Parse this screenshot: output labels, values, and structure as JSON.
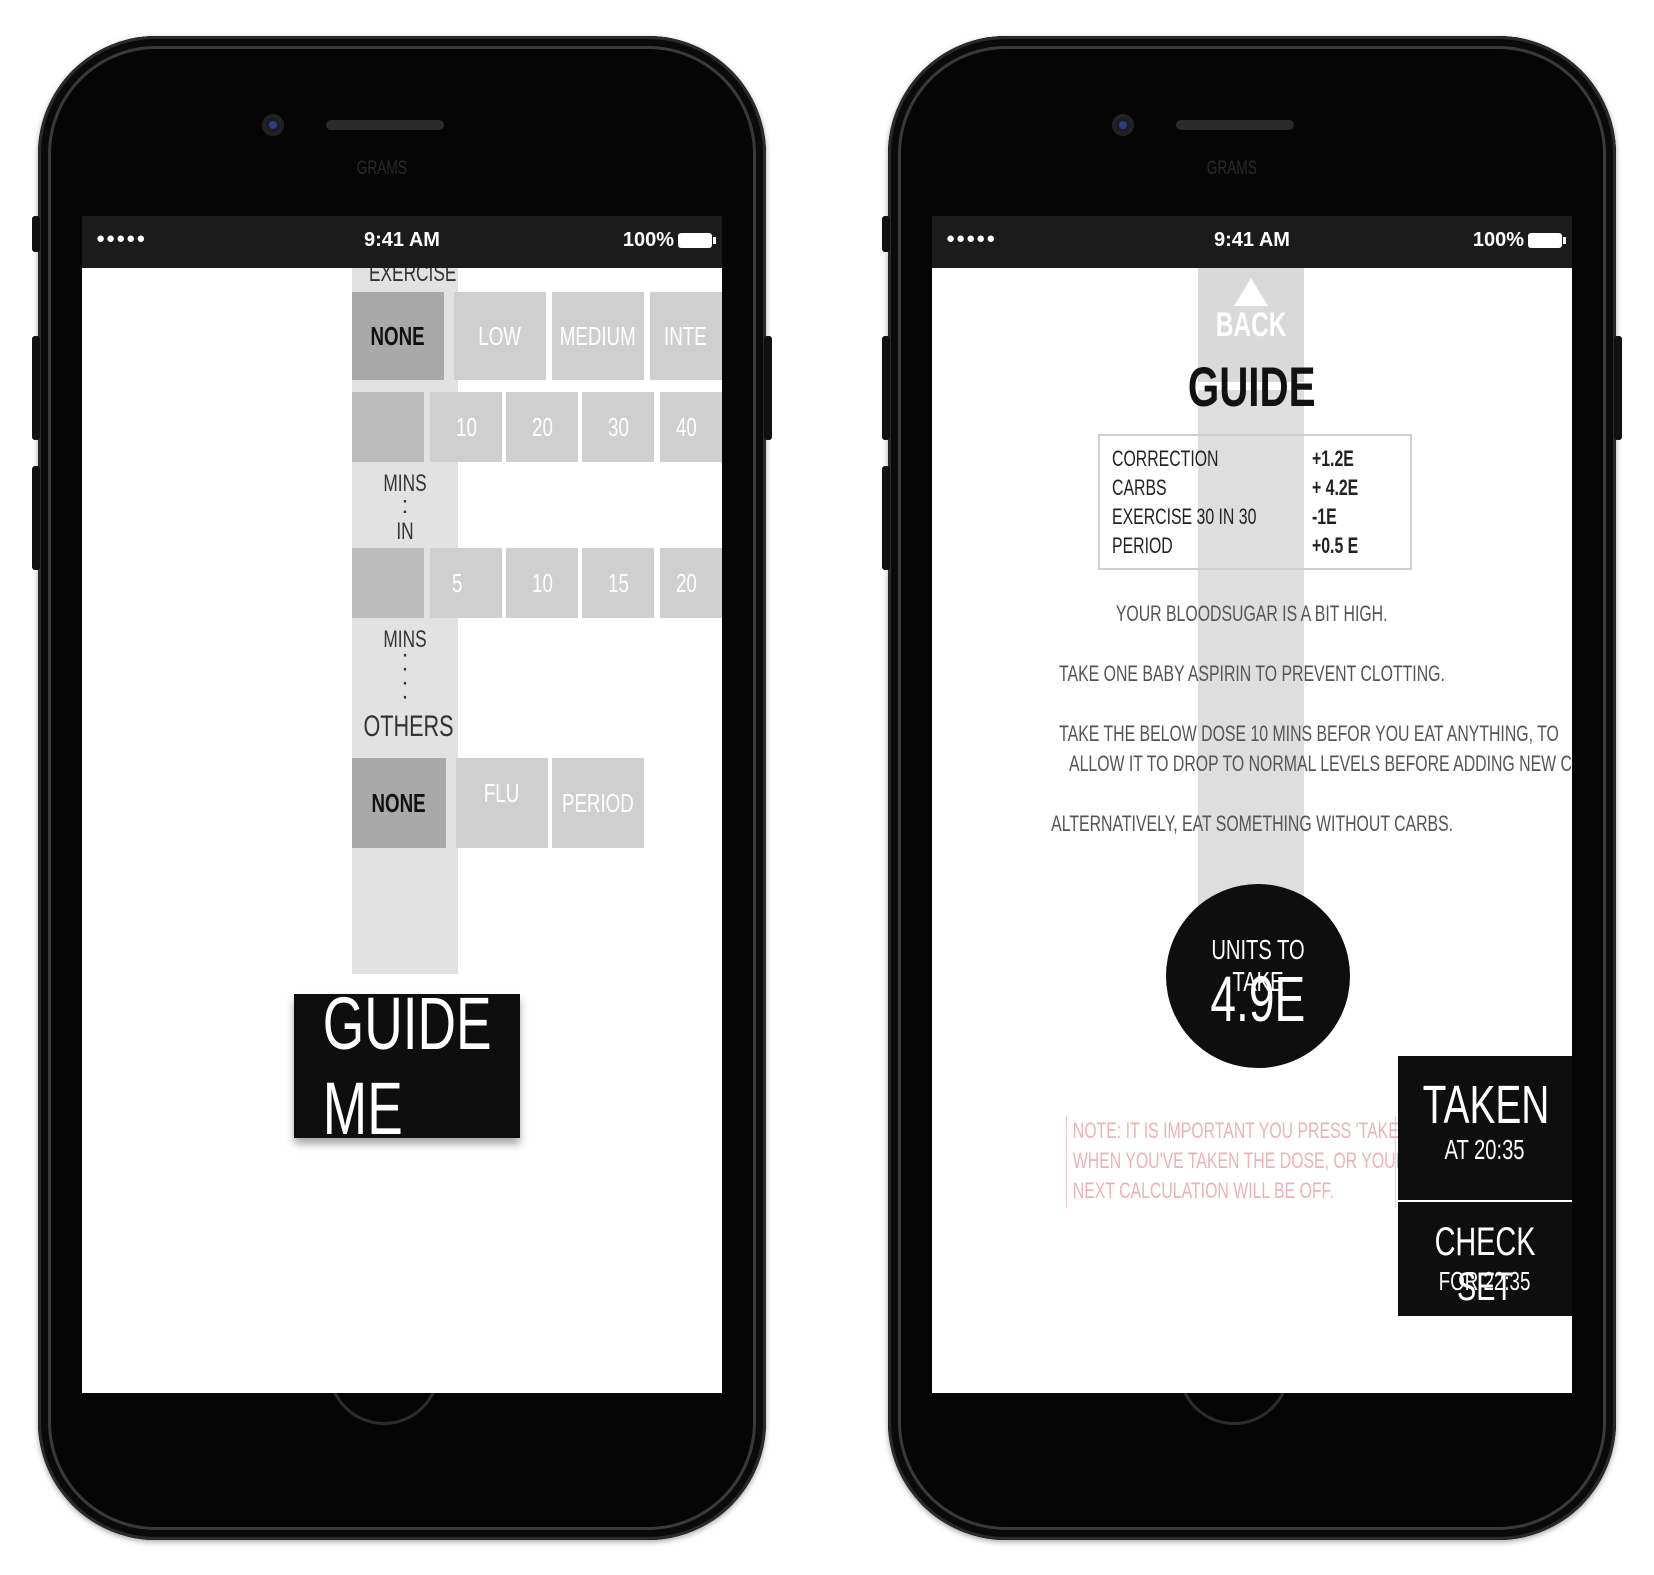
{
  "status_bar": {
    "signal": "●●●●● ",
    "time": "9:41 AM",
    "battery": "100%"
  },
  "ghost_label": "GRAMS",
  "left_screen": {
    "exercise_label": "EXERCISE",
    "intensity_options": [
      {
        "label": "NONE",
        "selected": true
      },
      {
        "label": "LOW",
        "selected": false
      },
      {
        "label": "MEDIUM",
        "selected": false
      },
      {
        "label": "INTE",
        "selected": false
      }
    ],
    "duration_options": [
      "10",
      "20",
      "30",
      "40"
    ],
    "mins_label": "MINS",
    "in_label": "IN",
    "start_options": [
      "5",
      "10",
      "15",
      "20"
    ],
    "mins_label_2": "MINS",
    "others_label": "OTHERS",
    "others_options": [
      {
        "label": "NONE",
        "selected": true
      },
      {
        "label": "FLU",
        "selected": false
      },
      {
        "label": "PERIOD",
        "selected": false
      }
    ],
    "guide_button": "GUIDE ME"
  },
  "right_screen": {
    "back_label": "BACK",
    "title": "GUIDE",
    "breakdown": [
      {
        "item": "CORRECTION",
        "value": "+1.2E"
      },
      {
        "item": "CARBS",
        "value": "+ 4.2E"
      },
      {
        "item": "EXERCISE 30 IN 30",
        "value": "-1E"
      },
      {
        "item": "PERIOD",
        "value": "+0.5 E"
      }
    ],
    "messages": {
      "high": "YOUR BLOODSUGAR IS A BIT HIGH.",
      "aspirin": "TAKE ONE BABY ASPIRIN TO PREVENT CLOTTING.",
      "dose_line1": "TAKE THE BELOW DOSE 10 MINS BEFOR YOU EAT ANYTHING, TO",
      "dose_line2": "ALLOW IT TO DROP TO NORMAL LEVELS BEFORE ADDING NEW CARBS.",
      "alternative": "ALTERNATIVELY, EAT SOMETHING WITHOUT CARBS."
    },
    "units_caption": "UNITS TO TAKE",
    "units_value": "4.9E",
    "note_lines": [
      "NOTE: IT IS IMPORTANT YOU PRESS 'TAKEN'",
      "WHEN YOU'VE TAKEN THE DOSE, OR YOUR",
      "NEXT CALCULATION WILL BE OFF."
    ],
    "taken_label": "TAKEN",
    "taken_time": "AT 20:35",
    "check_label": "CHECK SET",
    "check_time": "FOR 22:35"
  },
  "colors": {
    "accent_dark": "#0e0e0e",
    "tile_gray": "#cfcfcf",
    "tile_selected": "#a9a9a9",
    "note_pink": "#eab3b8"
  }
}
